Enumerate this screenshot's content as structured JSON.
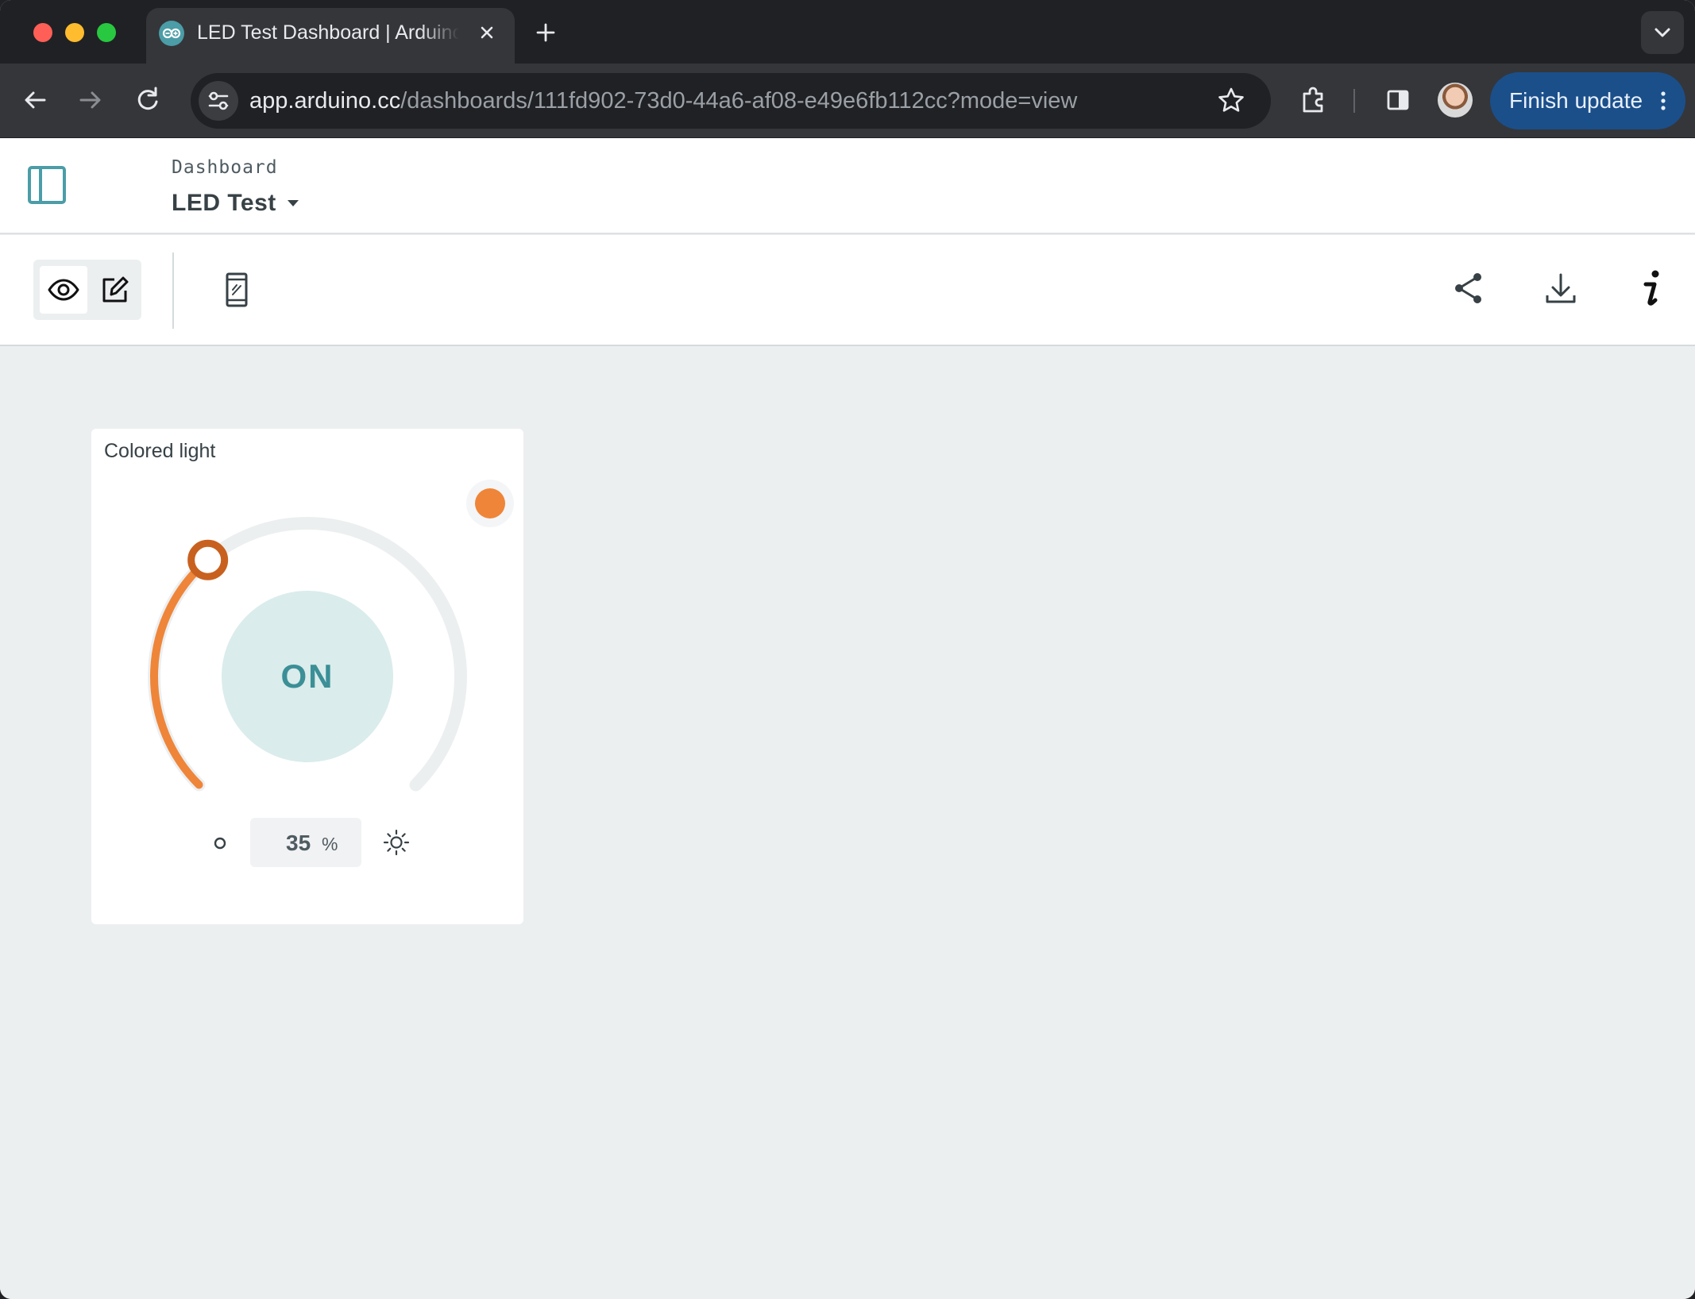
{
  "browser": {
    "tab": {
      "title": "LED Test Dashboard | Arduino Cloud",
      "favicon": "arduino-icon"
    },
    "address_bar": {
      "host": "app.arduino.cc",
      "path": "/dashboards/111fd902-73d0-44a6-af08-e49e6fb112cc?mode=view"
    },
    "update_button_label": "Finish update"
  },
  "app_header": {
    "breadcrumb_label": "Dashboard",
    "dashboard_name": "LED Test"
  },
  "toolbar": {
    "modes": [
      "view",
      "edit"
    ],
    "active_mode": "view"
  },
  "widget": {
    "title": "Colored light",
    "state_label": "ON",
    "brightness": {
      "value": "35",
      "unit": "%",
      "fraction": 0.35
    },
    "color_swatch": "#ef8539"
  },
  "colors": {
    "accent_teal": "#4b9da7",
    "light_orange": "#ef8539",
    "knob_orange": "#c8611f",
    "track": "#eceff0",
    "update_button": "#1b4f8a"
  }
}
